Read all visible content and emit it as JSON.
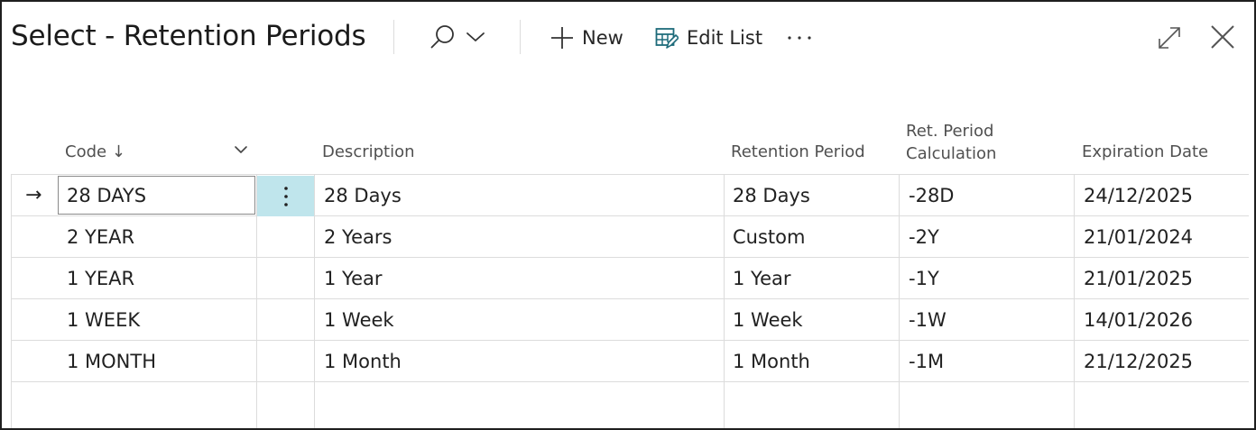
{
  "title": "Select - Retention Periods",
  "toolbar": {
    "search_icon": "search-icon",
    "new_label": "New",
    "edit_list_label": "Edit List",
    "more_icon": "ellipsis-icon"
  },
  "window_controls": {
    "expand_icon": "expand-icon",
    "close_icon": "close-icon"
  },
  "table": {
    "headers": {
      "code": "Code",
      "sort_indicator": "↓",
      "description": "Description",
      "retention_period": "Retention Period",
      "calc_line1": "Ret. Period",
      "calc_line2": "Calculation",
      "expiration_date": "Expiration Date"
    },
    "selected_row_marker": "→",
    "rows": [
      {
        "code": "28 DAYS",
        "description": "28 Days",
        "retention_period": "28 Days",
        "calculation": "-28D",
        "expiration_date": "24/12/2025"
      },
      {
        "code": "2 YEAR",
        "description": "2 Years",
        "retention_period": "Custom",
        "calculation": "-2Y",
        "expiration_date": "21/01/2024"
      },
      {
        "code": "1 YEAR",
        "description": "1 Year",
        "retention_period": "1 Year",
        "calculation": "-1Y",
        "expiration_date": "21/01/2025"
      },
      {
        "code": "1 WEEK",
        "description": "1 Week",
        "retention_period": "1 Week",
        "calculation": "-1W",
        "expiration_date": "14/01/2026"
      },
      {
        "code": "1 MONTH",
        "description": "1 Month",
        "retention_period": "1 Month",
        "calculation": "-1M",
        "expiration_date": "21/12/2025"
      }
    ]
  }
}
